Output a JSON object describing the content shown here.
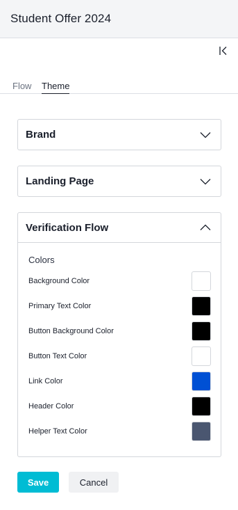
{
  "header": {
    "title": "Student Offer 2024"
  },
  "tabs": [
    {
      "label": "Flow",
      "active": false
    },
    {
      "label": "Theme",
      "active": true
    }
  ],
  "panels": {
    "brand": {
      "label": "Brand",
      "expanded": false
    },
    "landing": {
      "label": "Landing Page",
      "expanded": false
    },
    "verification": {
      "label": "Verification Flow",
      "expanded": true,
      "section_title": "Colors",
      "colors": [
        {
          "label": "Background Color",
          "value": "#ffffff"
        },
        {
          "label": "Primary Text Color",
          "value": "#000000"
        },
        {
          "label": "Button Background Color",
          "value": "#000000"
        },
        {
          "label": "Button Text Color",
          "value": "#ffffff"
        },
        {
          "label": "Link Color",
          "value": "#0050d4"
        },
        {
          "label": "Header Color",
          "value": "#000000"
        },
        {
          "label": "Helper Text Color",
          "value": "#4a5670"
        }
      ]
    }
  },
  "actions": {
    "save_label": "Save",
    "cancel_label": "Cancel"
  },
  "icons": {
    "collapse": "collapse-left-icon",
    "chevron_down": "chevron-down-icon",
    "chevron_up": "chevron-up-icon"
  },
  "theme": {
    "accent": "#00bcd4"
  }
}
